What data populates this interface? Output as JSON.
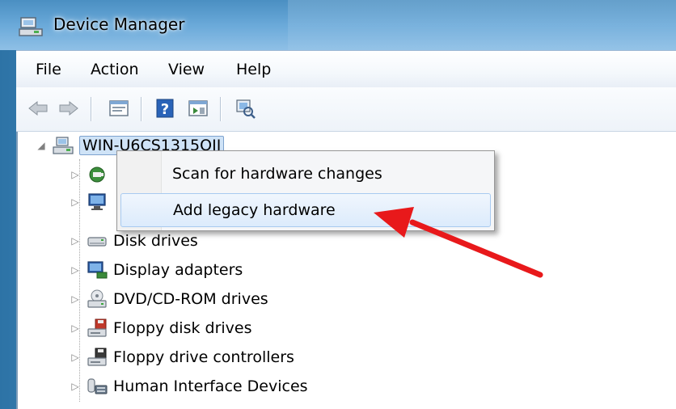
{
  "window": {
    "title": "Device Manager"
  },
  "menu": [
    "File",
    "Action",
    "View",
    "Help"
  ],
  "toolbar": {
    "buttons": [
      "back-arrow-icon",
      "forward-arrow-icon",
      "properties-icon",
      "help-icon",
      "update-driver-icon",
      "scan-hardware-icon"
    ]
  },
  "tree": {
    "root": "WIN-U6CS1315OIJ",
    "items": [
      {
        "label": "",
        "icon": "batteries-icon"
      },
      {
        "label": "",
        "icon": "computer-icon"
      },
      {
        "label": "Disk drives",
        "icon": "disk-drive-icon"
      },
      {
        "label": "Display adapters",
        "icon": "display-adapter-icon"
      },
      {
        "label": "DVD/CD-ROM drives",
        "icon": "dvd-drive-icon"
      },
      {
        "label": "Floppy disk drives",
        "icon": "floppy-drive-icon"
      },
      {
        "label": "Floppy drive controllers",
        "icon": "floppy-controller-icon"
      },
      {
        "label": "Human Interface Devices",
        "icon": "hid-icon"
      }
    ]
  },
  "context_menu": {
    "items": [
      {
        "label": "Scan for hardware changes",
        "highlighted": false
      },
      {
        "label": "Add legacy hardware",
        "highlighted": true
      }
    ]
  },
  "annotation": {
    "color": "#e8191b"
  }
}
